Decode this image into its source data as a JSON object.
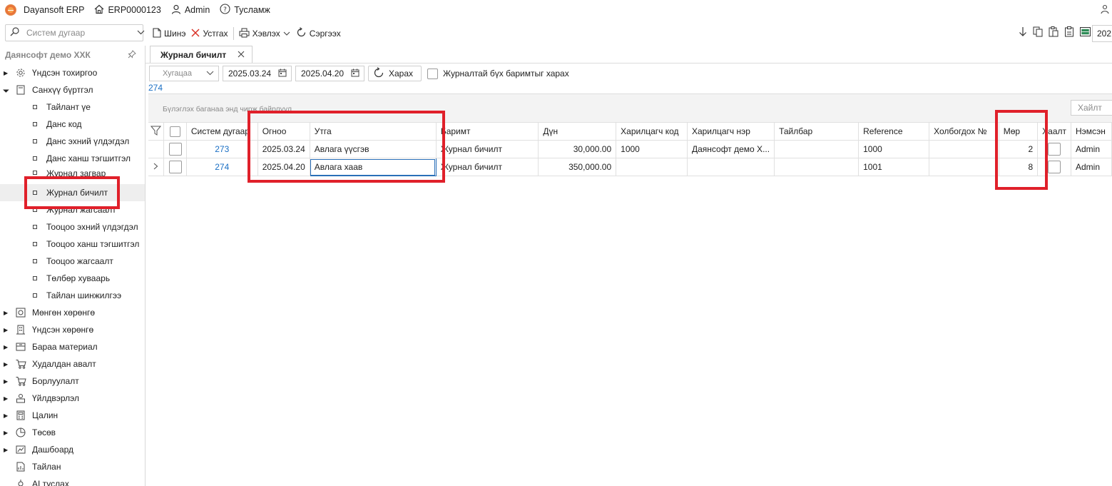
{
  "topbar": {
    "app_name": "Dayansoft ERP",
    "company_code": "ERP0000123",
    "user": "Admin",
    "help": "Тусламж"
  },
  "toolbar": {
    "search_placeholder": "Систем дугаар",
    "new_label": "Шинэ",
    "delete_label": "Устгах",
    "print_label": "Хэвлэх",
    "refresh_label": "Сэргээх",
    "year_value": "202"
  },
  "sidebar": {
    "company": "Даянсофт демо ХХК",
    "items": [
      {
        "label": "Үндсэн тохиргоо",
        "icon": "gear-icon",
        "expanded": false
      },
      {
        "label": "Санхүү бүртгэл",
        "icon": "ledger-icon",
        "expanded": true,
        "children": [
          "Тайлант үе",
          "Данс код",
          "Данс эхний үлдэгдэл",
          "Данс ханш тэгшитгэл",
          "Журнал загвар",
          "Журнал бичилт",
          "Журнал жагсаалт",
          "Тооцоо эхний үлдэгдэл",
          "Тооцоо ханш тэгшитгэл",
          "Тооцоо жагсаалт",
          "Төлбөр хуваарь",
          "Тайлан шинжилгээ"
        ]
      },
      {
        "label": "Мөнгөн хөрөнгө",
        "icon": "safe-icon",
        "expanded": false
      },
      {
        "label": "Үндсэн хөрөнгө",
        "icon": "building-icon",
        "expanded": false
      },
      {
        "label": "Бараа материал",
        "icon": "inventory-icon",
        "expanded": false
      },
      {
        "label": "Худалдан авалт",
        "icon": "cart-icon",
        "expanded": false
      },
      {
        "label": "Борлуулалт",
        "icon": "sales-cart-icon",
        "expanded": false
      },
      {
        "label": "Үйлдвэрлэл",
        "icon": "factory-icon",
        "expanded": false
      },
      {
        "label": "Цалин",
        "icon": "calculator-icon",
        "expanded": false
      },
      {
        "label": "Төсөв",
        "icon": "pie-icon",
        "expanded": false
      },
      {
        "label": "Дашбоард",
        "icon": "dashboard-icon",
        "expanded": false
      },
      {
        "label": "Тайлан",
        "icon": "report-icon",
        "expanded": false
      },
      {
        "label": "AI туслах",
        "icon": "ai-icon",
        "expanded": false
      }
    ],
    "selected": "Журнал бичилт"
  },
  "tabs": [
    {
      "label": "Журнал бичилт",
      "active": true
    }
  ],
  "filters": {
    "period_placeholder": "Хугацаа",
    "date_from": "2025.03.24",
    "date_to": "2025.04.20",
    "view_button": "Харах",
    "show_all_label": "Журналтай бүх баримтыг харах"
  },
  "record_count": "274",
  "grid": {
    "group_hint": "Бүлэглэх баганаа энд чирж байрлуул",
    "search_placeholder": "Хайлт",
    "columns": [
      "Систем дугаар",
      "Огноо",
      "Утга",
      "Баримт",
      "Дүн",
      "Харилцагч код",
      "Харилцагч нэр",
      "Тайлбар",
      "Reference",
      "Холбогдох №",
      "Мөр",
      "Хаалт",
      "Нэмсэн"
    ],
    "rows": [
      {
        "sys_no": "273",
        "date": "2025.03.24",
        "desc": "Авлага үүсгэв",
        "doc": "Журнал бичилт",
        "amount": "30,000.00",
        "partner_code": "1000",
        "partner_name": "Даянсофт демо Х...",
        "note": "",
        "reference": "1000",
        "related_no": "",
        "lines": "2",
        "created_by": "Admin"
      },
      {
        "sys_no": "274",
        "date": "2025.04.20",
        "desc": "Авлага хаав",
        "doc": "Журнал бичилт",
        "amount": "350,000.00",
        "partner_code": "",
        "partner_name": "",
        "note": "",
        "reference": "1001",
        "related_no": "",
        "lines": "8",
        "created_by": "Admin"
      }
    ]
  },
  "colors": {
    "highlight": "#e0202a",
    "link": "#1a6fc4",
    "edit_border": "#2a6fb8"
  }
}
